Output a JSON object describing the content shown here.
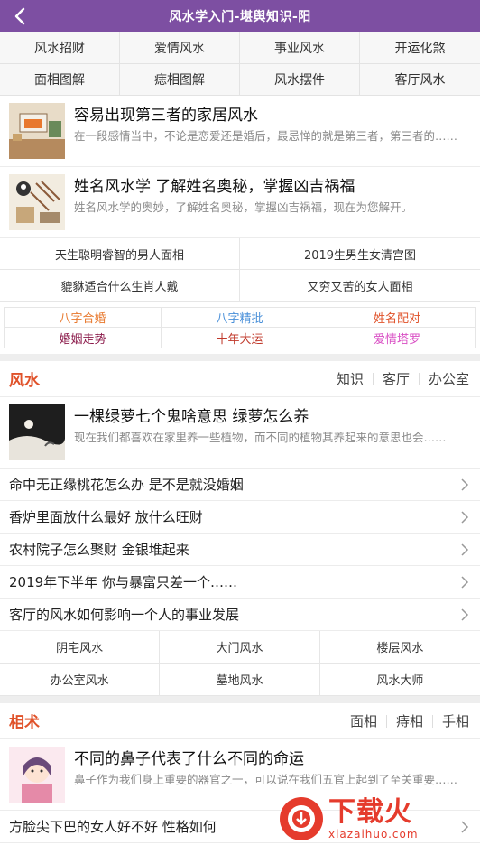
{
  "header": {
    "title": "风水学入门-堪舆知识-阳"
  },
  "top_grid": [
    "风水招财",
    "爱情风水",
    "事业风水",
    "开运化煞",
    "面相图解",
    "痣相图解",
    "风水摆件",
    "客厅风水"
  ],
  "top_articles": [
    {
      "title": "容易出现第三者的家居风水",
      "desc": "在一段感情当中，不论是恋爱还是婚后，最忌惮的就是第三者，第三者的……"
    },
    {
      "title": "姓名风水学 了解姓名奥秘，掌握凶吉祸福",
      "desc": "姓名风水学的奥妙，了解姓名奥秘，掌握凶吉祸福，现在为您解开。"
    }
  ],
  "two_col_links": [
    "天生聪明睿智的男人面相",
    "2019生男生女清宫图",
    "貔貅适合什么生肖人戴",
    "又穷又苦的女人面相"
  ],
  "tags": [
    {
      "label": "八字合婚",
      "color": "#e8792e"
    },
    {
      "label": "八字精批",
      "color": "#4a90d9"
    },
    {
      "label": "姓名配对",
      "color": "#e0522a"
    },
    {
      "label": "婚姻走势",
      "color": "#8b1a4a"
    },
    {
      "label": "十年大运",
      "color": "#c0392b"
    },
    {
      "label": "爱情塔罗",
      "color": "#d94fc4"
    }
  ],
  "fengshui": {
    "name": "风水",
    "links": [
      "知识",
      "客厅",
      "办公室"
    ],
    "article": {
      "title": "一棵绿萝七个鬼啥意思 绿萝怎么养",
      "desc": "现在我们都喜欢在家里养一些植物，而不同的植物其养起来的意思也会……"
    },
    "rows": [
      "命中无正缘桃花怎么办 是不是就没婚姻",
      "香炉里面放什么最好 放什么旺财",
      "农村院子怎么聚财 金银堆起来",
      "2019年下半年 你与暴富只差一个……",
      "客厅的风水如何影响一个人的事业发展"
    ],
    "grid": [
      "阴宅风水",
      "大门风水",
      "楼层风水",
      "办公室风水",
      "墓地风水",
      "风水大师"
    ]
  },
  "xiangshu": {
    "name": "相术",
    "links": [
      "面相",
      "痔相",
      "手相"
    ],
    "article": {
      "title": "不同的鼻子代表了什么不同的命运",
      "desc": "鼻子作为我们身上重要的器官之一，可以说在我们五官上起到了至关重要……"
    },
    "rows": [
      "方脸尖下巴的女人好不好 性格如何"
    ]
  },
  "watermark": {
    "big": "下载火",
    "small": "xiazaihuo.com"
  },
  "colors": {
    "header": "#7d4fa2",
    "section_title": "#e0522a"
  }
}
